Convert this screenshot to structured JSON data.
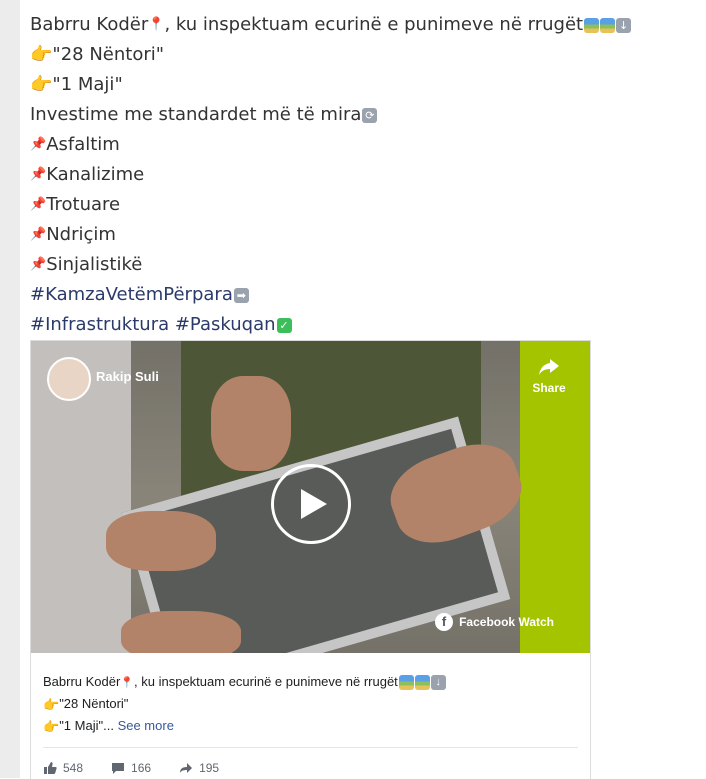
{
  "post": {
    "lines": [
      {
        "text": "Babrru Kodër",
        "pin_emoji": "📍",
        "rest": ", ku inspektuam ecurinë e punimeve në rrugët"
      },
      {
        "text": "\"28 Nëntori\""
      },
      {
        "text": "\"1 Maji\""
      },
      {
        "text": "Investime me standardet më të mira"
      },
      {
        "text": "Asfaltim"
      },
      {
        "text": "Kanalizime"
      },
      {
        "text": "Trotuare"
      },
      {
        "text": "Ndriçim"
      },
      {
        "text": "Sinjalistikë"
      },
      {
        "text": "#KamzaVetëmPërpara"
      },
      {
        "text": "#Infrastruktura #Paskuqan"
      }
    ]
  },
  "video": {
    "owner_name": "Rakip Suli",
    "share_label": "Share",
    "watermark": "Facebook Watch"
  },
  "card": {
    "desc_line1": "Babrru Kodër",
    "desc_line1_rest": ", ku inspektuam ecurinë e punimeve në rrugët",
    "desc_line2": "\"28 Nëntori\"",
    "desc_line3": "\"1 Maji\"...",
    "see_more": "See more",
    "likes": "548",
    "comments": "166",
    "shares": "195"
  },
  "colors": {
    "accent": "#385898",
    "hashtag": "#2a3a6a",
    "text": "#333333"
  }
}
